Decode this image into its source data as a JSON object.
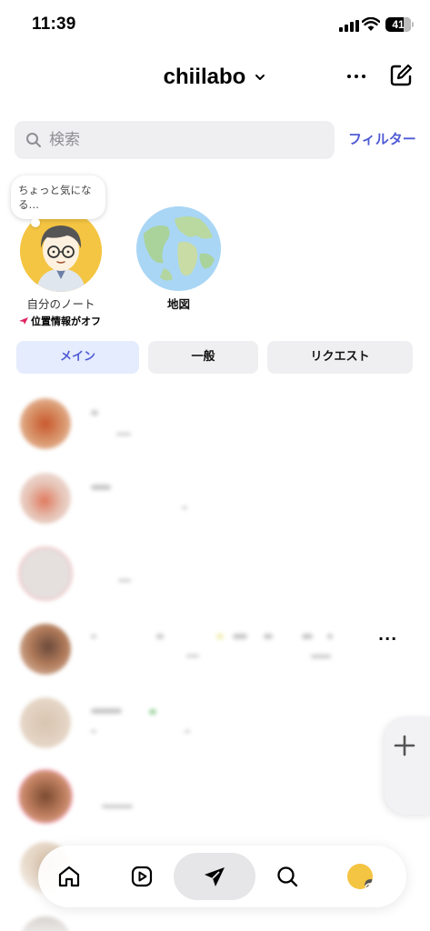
{
  "status_bar": {
    "time": "11:39",
    "battery": "41"
  },
  "header": {
    "account_name": "chiilabo"
  },
  "search": {
    "placeholder": "検索",
    "filter_label": "フィルター"
  },
  "notes": {
    "my_note": {
      "bubble_text": "ちょっと気になる…",
      "label": "自分のノート",
      "location_status": "位置情報がオフ"
    },
    "map": {
      "label": "地図"
    }
  },
  "tabs": [
    {
      "label": "メイン",
      "active": true
    },
    {
      "label": "一般",
      "active": false
    },
    {
      "label": "リクエスト",
      "active": false
    }
  ],
  "row_menu": "···",
  "colors": {
    "accent": "#4f5bd5",
    "active_tab_bg": "#e4ecfd",
    "field_bg": "#efeff1"
  },
  "icons": [
    "chevron-down-icon",
    "more-icon",
    "compose-icon",
    "search-icon",
    "airplane-icon",
    "plus-icon",
    "home-icon",
    "reels-icon",
    "direct-icon",
    "explore-icon"
  ]
}
